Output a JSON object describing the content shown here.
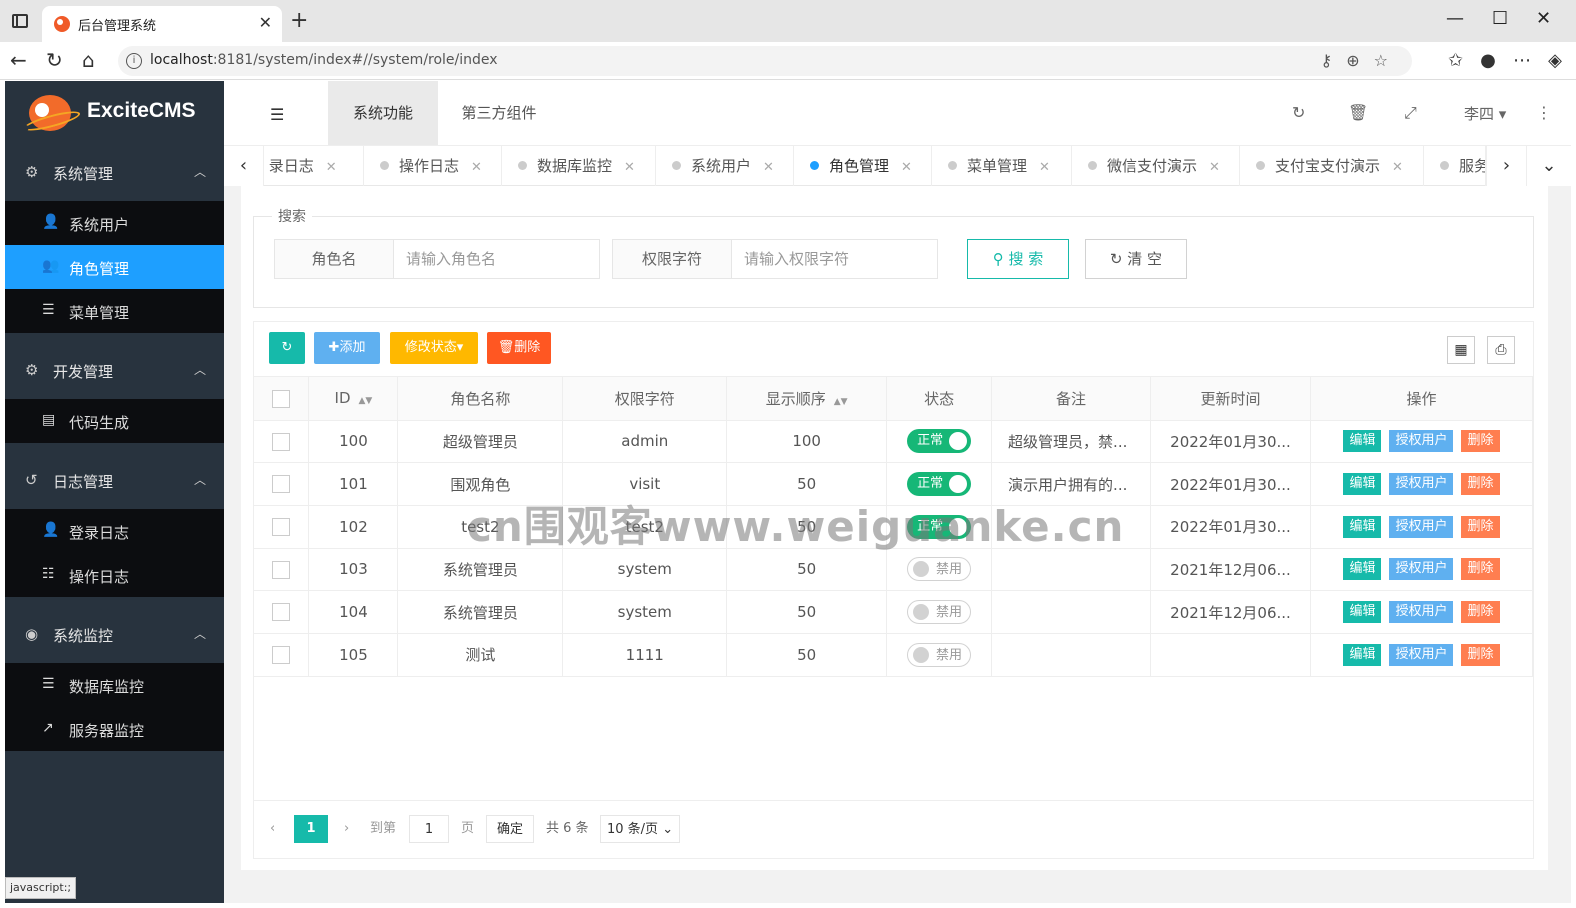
{
  "browser": {
    "tab_title": "后台管理系统",
    "url_host": "localhost",
    "url_rest": ":8181/system/index#//system/role/index"
  },
  "app": {
    "brand": "ExciteCMS",
    "status_hint": "javascript:;"
  },
  "sidebar": {
    "groups": [
      {
        "label": "系统管理",
        "items": [
          {
            "label": "系统用户"
          },
          {
            "label": "角色管理"
          },
          {
            "label": "菜单管理"
          }
        ]
      },
      {
        "label": "开发管理",
        "items": [
          {
            "label": "代码生成"
          }
        ]
      },
      {
        "label": "日志管理",
        "items": [
          {
            "label": "登录日志"
          },
          {
            "label": "操作日志"
          }
        ]
      },
      {
        "label": "系统监控",
        "items": [
          {
            "label": "数据库监控"
          },
          {
            "label": "服务器监控"
          }
        ]
      }
    ]
  },
  "header": {
    "tabs": [
      {
        "label": "系统功能"
      },
      {
        "label": "第三方组件"
      }
    ],
    "user": "李四"
  },
  "pagetabs": [
    {
      "label": "录日志"
    },
    {
      "label": "操作日志"
    },
    {
      "label": "数据库监控"
    },
    {
      "label": "系统用户"
    },
    {
      "label": "角色管理"
    },
    {
      "label": "菜单管理"
    },
    {
      "label": "微信支付演示"
    },
    {
      "label": "支付宝支付演示"
    },
    {
      "label": "服务器"
    }
  ],
  "search": {
    "legend": "搜索",
    "role_label": "角色名",
    "role_placeholder": "请输入角色名",
    "perm_label": "权限字符",
    "perm_placeholder": "请输入权限字符",
    "search_btn": "搜 索",
    "clear_btn": "清 空"
  },
  "toolbar": {
    "add": "添加",
    "modify": "修改状态",
    "delete": "删除"
  },
  "table": {
    "headers": [
      "ID",
      "角色名称",
      "权限字符",
      "显示顺序",
      "状态",
      "备注",
      "更新时间",
      "操作"
    ],
    "rows": [
      {
        "id": "100",
        "name": "超级管理员",
        "key": "admin",
        "order": "100",
        "status": "正常",
        "note": "超级管理员，禁...",
        "time": "2022年01月30..."
      },
      {
        "id": "101",
        "name": "围观角色",
        "key": "visit",
        "order": "50",
        "status": "正常",
        "note": "演示用户拥有的...",
        "time": "2022年01月30..."
      },
      {
        "id": "102",
        "name": "test2",
        "key": "test2",
        "order": "50",
        "status": "正常",
        "note": "",
        "time": "2022年01月30..."
      },
      {
        "id": "103",
        "name": "系统管理员",
        "key": "system",
        "order": "50",
        "status": "禁用",
        "note": "",
        "time": "2021年12月06..."
      },
      {
        "id": "104",
        "name": "系统管理员",
        "key": "system",
        "order": "50",
        "status": "禁用",
        "note": "",
        "time": "2021年12月06..."
      },
      {
        "id": "105",
        "name": "测试",
        "key": "1111",
        "order": "50",
        "status": "禁用",
        "note": "",
        "time": ""
      }
    ],
    "actions": {
      "edit": "编辑",
      "auth": "授权用户",
      "del": "删除"
    }
  },
  "pager": {
    "current": "1",
    "goto": "到第",
    "page_value": "1",
    "page_unit": "页",
    "confirm": "确定",
    "total": "共 6 条",
    "size": "10 条/页"
  },
  "watermark": "cn围观客www.weiguanke.cn"
}
